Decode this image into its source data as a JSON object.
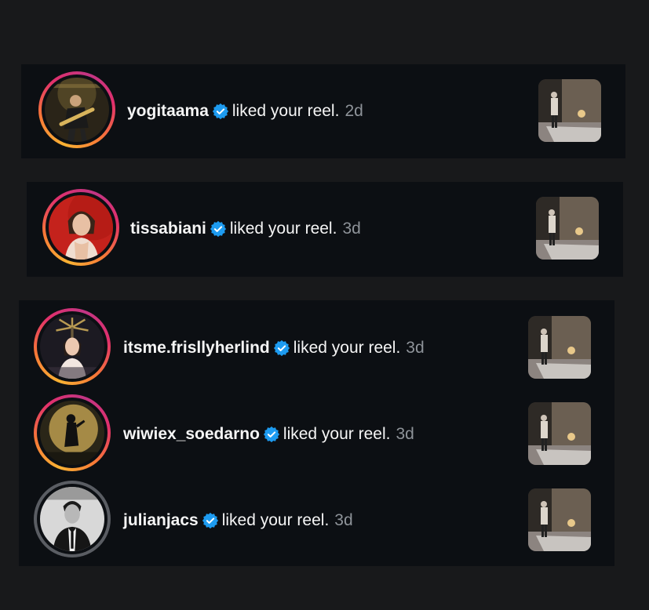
{
  "notifications": [
    {
      "username": "yogitaama",
      "action": "liked your reel.",
      "time": "2d",
      "story_ring": "active",
      "avatar_icon": "avatar-guitarist"
    },
    {
      "username": "tissabiani",
      "action": "liked your reel.",
      "time": "3d",
      "story_ring": "active",
      "avatar_icon": "avatar-woman-red"
    },
    {
      "username": "itsme.frisllyherlind",
      "action": "liked your reel.",
      "time": "3d",
      "story_ring": "active",
      "avatar_icon": "avatar-woman-palm"
    },
    {
      "username": "wiwiex_soedarno",
      "action": "liked your reel.",
      "time": "3d",
      "story_ring": "active",
      "avatar_icon": "avatar-moon-silhouette"
    },
    {
      "username": "julianjacs",
      "action": "liked your reel.",
      "time": "3d",
      "story_ring": "seen",
      "avatar_icon": "avatar-man-suit"
    }
  ],
  "verified_icon": "verified-badge-icon",
  "colors": {
    "background": "#18191b",
    "card": "#0c0f13",
    "text": "#f5f5f5",
    "muted": "#8e9399",
    "verified": "#1d9bf0",
    "story_ring": [
      "#f9b233",
      "#f77737",
      "#e1306c",
      "#c13584"
    ],
    "seen_ring": "#5a5d63"
  }
}
